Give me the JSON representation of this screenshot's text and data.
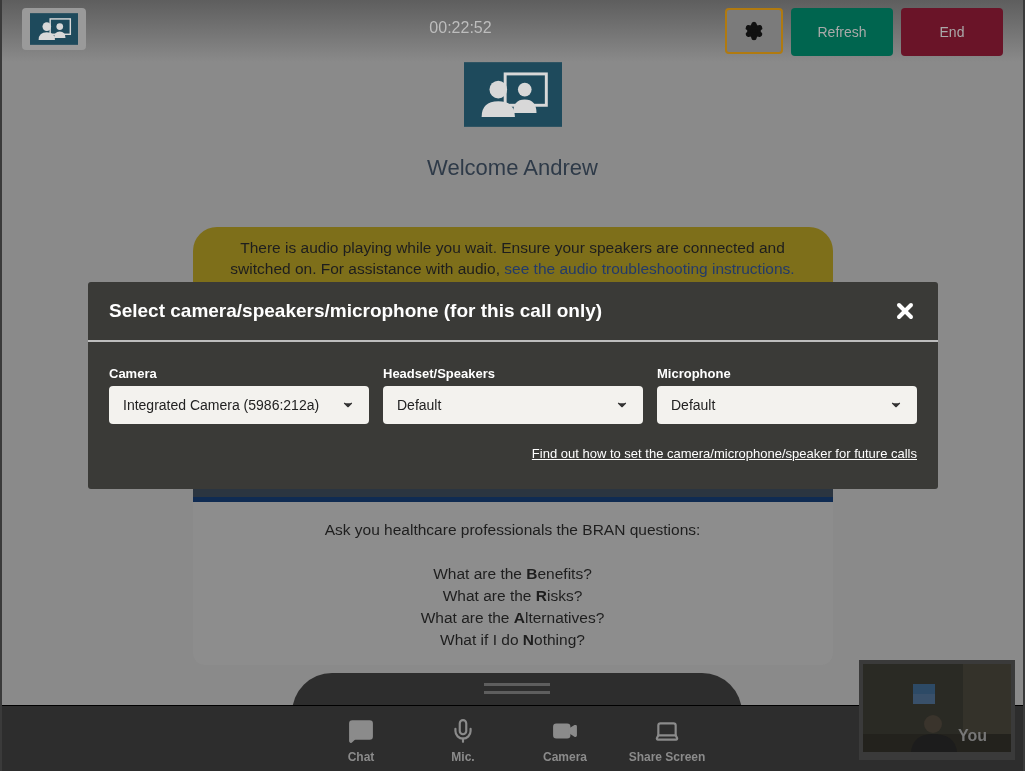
{
  "header": {
    "timer": "00:22:52",
    "buttons": [
      {
        "kind": "settings"
      },
      {
        "kind": "refresh",
        "label": "Refresh"
      },
      {
        "kind": "end",
        "label": "End"
      }
    ]
  },
  "welcome": "Welcome Andrew",
  "notice": {
    "text": "There is audio playing while you wait. Ensure your speakers are connected and switched on. For assistance with audio, ",
    "link": "see the audio troubleshooting instructions."
  },
  "bran_card": {
    "intro": "Ask you healthcare professionals the BRAN questions:",
    "questions": [
      "What are the **B**enefits?",
      "What are the **R**isks?",
      "What are the **A**lternatives?",
      "What if I do **N**othing?"
    ]
  },
  "modal": {
    "title": "Select camera/speakers/microphone (for this call only)",
    "fields": [
      {
        "label": "Camera",
        "value": "Integrated Camera (5986:212a)"
      },
      {
        "label": "Headset/Speakers",
        "value": "Default"
      },
      {
        "label": "Microphone",
        "value": "Default"
      }
    ],
    "help_link": "Find out how to set the camera/microphone/speaker for future calls"
  },
  "toolbar": [
    {
      "kind": "chat",
      "label": "Chat"
    },
    {
      "kind": "mic",
      "label": "Mic."
    },
    {
      "kind": "camera",
      "label": "Camera"
    },
    {
      "kind": "share",
      "label": "Share Screen"
    }
  ],
  "self_view": {
    "label": "You"
  }
}
